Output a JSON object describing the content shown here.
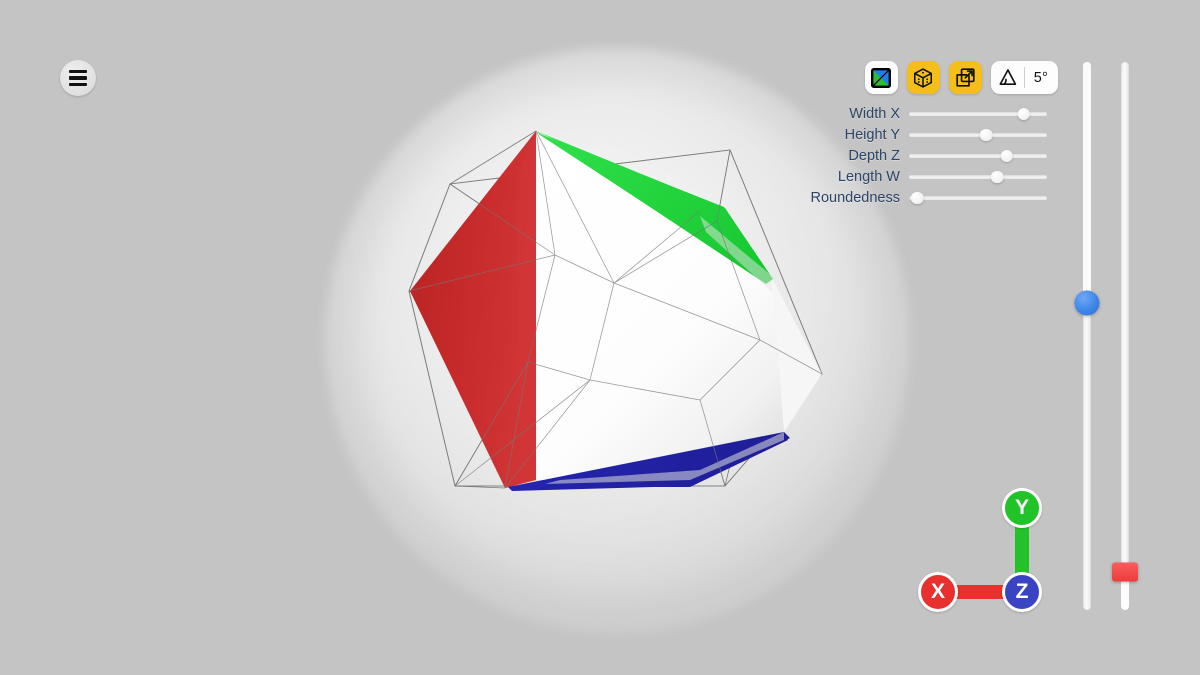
{
  "app": {
    "background_color": "#c4c4c4",
    "menu_button": {
      "icon": "hamburger-icon",
      "label": "Menu"
    }
  },
  "toolbar": {
    "items": [
      {
        "name": "shading-mode-button",
        "icon": "split-square-blue-green-icon",
        "active": true,
        "style": "white"
      },
      {
        "name": "cube-view-button",
        "icon": "dice-cube-icon",
        "active": true,
        "style": "yellow"
      },
      {
        "name": "expand-view-button",
        "icon": "expand-arrow-icon",
        "active": true,
        "style": "yellow"
      }
    ],
    "angle": {
      "name": "angle-snap-control",
      "icon": "angle-icon",
      "value": "5°"
    }
  },
  "parameters": {
    "rows": [
      {
        "label": "Width X",
        "value": 83
      },
      {
        "label": "Height Y",
        "value": 56
      },
      {
        "label": "Depth Z",
        "value": 71
      },
      {
        "label": "Length W",
        "value": 64
      },
      {
        "label": "Roundedness",
        "value": 6
      }
    ]
  },
  "vertical_sliders": [
    {
      "name": "rotation-slider",
      "thumb_color": "#3d86e8",
      "thumb_shape": "circle",
      "value_pct": 44
    },
    {
      "name": "zoom-slider",
      "thumb_color": "#ef3a3a",
      "thumb_shape": "rect",
      "value_pct": 93
    }
  ],
  "axis_gizmo": {
    "axes": [
      {
        "label": "X",
        "color": "#e8312f"
      },
      {
        "label": "Y",
        "color": "#22c329"
      },
      {
        "label": "Z",
        "color": "#3a43c4"
      }
    ]
  },
  "viewport": {
    "object_name": "tesseract-projection",
    "face_colors": {
      "left": "#c72b2b",
      "front": "#ffffff",
      "top_edge": "#22d93a",
      "bottom_edge": "#2222a8",
      "wireframe": "#5a5a5a"
    }
  }
}
